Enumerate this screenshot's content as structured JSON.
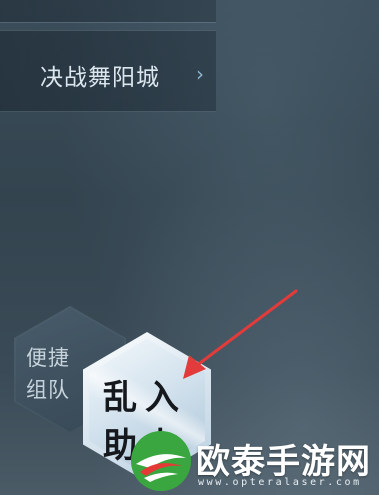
{
  "quest_panel": {
    "label": "决战舞阳城",
    "arrow_icon": "chevron-right-icon"
  },
  "quick_team": {
    "label": "便捷组队"
  },
  "join_button": {
    "label": "乱入助力",
    "label_visible": "乱入助"
  },
  "annotation": {
    "arrow_color": "#e23b3b"
  },
  "watermark": {
    "title": "欧泰手游网",
    "url": "www.opteralaser.com",
    "logo_colors": [
      "#3aa640",
      "#e53935",
      "#ffffff"
    ]
  }
}
